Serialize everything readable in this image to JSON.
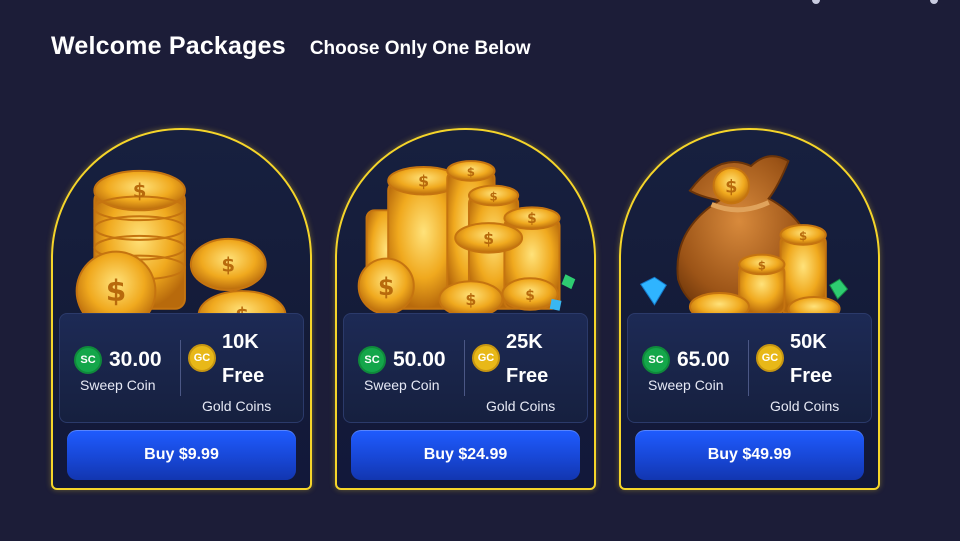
{
  "header": {
    "title": "Welcome Packages",
    "subtitle": "Choose Only One Below"
  },
  "packages": [
    {
      "sc_badge": "SC",
      "sc_amount": "30.00",
      "sc_label": "Sweep Coin",
      "gc_badge": "GC",
      "gc_amount": "10K",
      "gc_free": "Free",
      "gc_label": "Gold Coins",
      "buy_label": "Buy $9.99",
      "art_icon": "coin-stack-icon"
    },
    {
      "sc_badge": "SC",
      "sc_amount": "50.00",
      "sc_label": "Sweep Coin",
      "gc_badge": "GC",
      "gc_amount": "25K",
      "gc_free": "Free",
      "gc_label": "Gold Coins",
      "buy_label": "Buy $24.99",
      "art_icon": "coin-pile-icon"
    },
    {
      "sc_badge": "SC",
      "sc_amount": "65.00",
      "sc_label": "Sweep Coin",
      "gc_badge": "GC",
      "gc_amount": "50K",
      "gc_free": "Free",
      "gc_label": "Gold Coins",
      "buy_label": "Buy $49.99",
      "art_icon": "money-bag-icon"
    }
  ],
  "colors": {
    "background": "#1c1d38",
    "card_border": "#f5d52a",
    "button_blue": "#1f5cff",
    "sc_badge": "#14a64a",
    "gc_badge": "#e8b818"
  }
}
